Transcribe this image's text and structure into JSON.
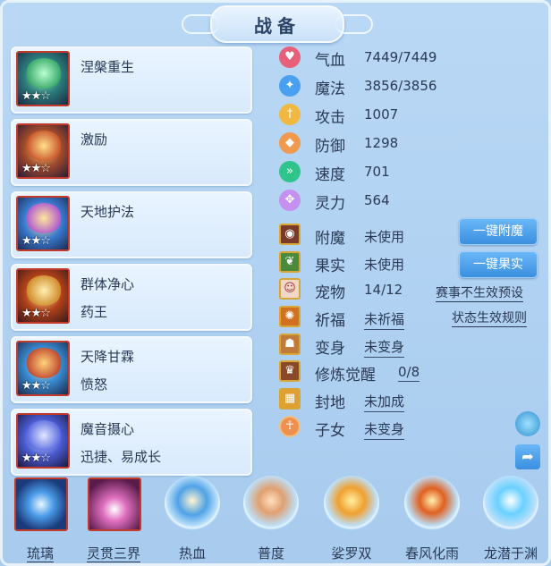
{
  "window": {
    "title": "战备"
  },
  "skills": [
    {
      "name": "涅槃重生",
      "sub": "",
      "stars": "★★☆"
    },
    {
      "name": "激励",
      "sub": "",
      "stars": "★★☆"
    },
    {
      "name": "天地护法",
      "sub": "",
      "stars": "★★☆"
    },
    {
      "name": "群体净心",
      "sub": "药王",
      "stars": "★★☆"
    },
    {
      "name": "天降甘霖",
      "sub": "愤怒",
      "stars": "★★☆"
    },
    {
      "name": "魔音摄心",
      "sub": "迅捷、易成长",
      "stars": "★★☆"
    }
  ],
  "stats": [
    {
      "icon": "heart-icon",
      "label": "气血",
      "value": "7449/7449",
      "color": "#e6607a"
    },
    {
      "icon": "mana-icon",
      "label": "魔法",
      "value": "3856/3856",
      "color": "#4aa0f0"
    },
    {
      "icon": "sword-icon",
      "label": "攻击",
      "value": "1007",
      "color": "#f0b840"
    },
    {
      "icon": "shield-icon",
      "label": "防御",
      "value": "1298",
      "color": "#f09a50"
    },
    {
      "icon": "speed-icon",
      "label": "速度",
      "value": "701",
      "color": "#2ec48a"
    },
    {
      "icon": "spirit-icon",
      "label": "灵力",
      "value": "564",
      "color": "#c690f0"
    }
  ],
  "attrs": [
    {
      "icon": "enchant-icon",
      "label": "附魔",
      "value": "未使用",
      "underline": false
    },
    {
      "icon": "fruit-icon",
      "label": "果实",
      "value": "未使用",
      "underline": false
    },
    {
      "icon": "pet-icon",
      "label": "宠物",
      "value": "14/12",
      "underline": false
    },
    {
      "icon": "blessing-icon",
      "label": "祈福",
      "value": "未祈福",
      "underline": true
    },
    {
      "icon": "transform-icon",
      "label": "变身",
      "value": "未变身",
      "underline": true
    },
    {
      "icon": "cultivation-icon",
      "label": "修炼觉醒",
      "value": "0/8",
      "underline": true
    },
    {
      "icon": "territory-icon",
      "label": "封地",
      "value": "未加成",
      "underline": true
    },
    {
      "icon": "child-icon",
      "label": "子女",
      "value": "未变身",
      "underline": true
    }
  ],
  "buttons": {
    "enchant": "一键附魔",
    "fruit": "一键果实"
  },
  "links": {
    "event": "赛事不生效预设",
    "status_rules": "状态生效规则"
  },
  "bottom_skills": [
    {
      "label": "琉璃",
      "underline": true,
      "square": true
    },
    {
      "label": "灵贯三界",
      "underline": true,
      "square": true
    },
    {
      "label": "热血",
      "underline": false,
      "square": false
    },
    {
      "label": "普度",
      "underline": false,
      "square": false
    },
    {
      "label": "娑罗双",
      "underline": false,
      "square": false
    },
    {
      "label": "春风化雨",
      "underline": false,
      "square": false
    },
    {
      "label": "龙潜于渊",
      "underline": false,
      "square": false
    }
  ]
}
